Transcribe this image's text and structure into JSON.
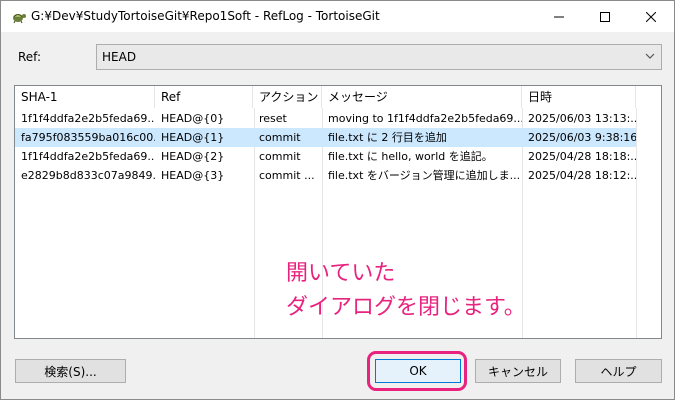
{
  "window": {
    "title": "G:¥Dev¥StudyTortoiseGit¥Repo1Soft - RefLog - TortoiseGit",
    "controls": [
      "minimize-icon",
      "maximize-icon",
      "close-icon"
    ]
  },
  "ref": {
    "label": "Ref:",
    "value": "HEAD"
  },
  "list": {
    "columns": [
      "SHA-1",
      "Ref",
      "アクション",
      "メッセージ",
      "日時"
    ],
    "rows": [
      {
        "sha": "1f1f4ddfa2e2b5feda69...",
        "ref": "HEAD@{0}",
        "action": "reset",
        "message": "moving to 1f1f4ddfa2e2b5feda69...",
        "date": "2025/06/03 13:13:..."
      },
      {
        "sha": "fa795f083559ba016c00...",
        "ref": "HEAD@{1}",
        "action": "commit",
        "message": "file.txt に 2 行目を追加",
        "date": "2025/06/03 9:38:16"
      },
      {
        "sha": "1f1f4ddfa2e2b5feda69...",
        "ref": "HEAD@{2}",
        "action": "commit",
        "message": "file.txt に hello, world を追記。",
        "date": "2025/04/28 18:18:..."
      },
      {
        "sha": "e2829b8d833c07a9849...",
        "ref": "HEAD@{3}",
        "action": "commit ...",
        "message": "file.txt をバージョン管理に追加しま...",
        "date": "2025/04/28 18:12:..."
      }
    ],
    "selected_row": 1
  },
  "buttons": {
    "search": "検索(S)...",
    "ok": "OK",
    "cancel": "キャンセル",
    "help": "ヘルプ"
  },
  "annotation": {
    "line1": "開いていた",
    "line2": "ダイアログを閉じます。",
    "color": "#e8237f"
  },
  "colors": {
    "selection": "#cce8ff",
    "ok_border": "#0078d7"
  }
}
